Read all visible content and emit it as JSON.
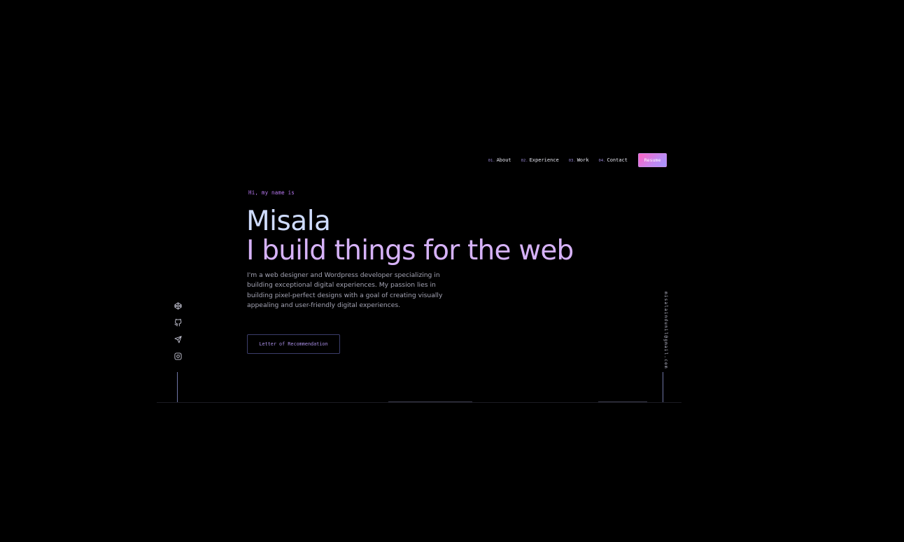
{
  "nav": {
    "items": [
      {
        "num": "01.",
        "label": "About"
      },
      {
        "num": "02.",
        "label": "Experience"
      },
      {
        "num": "03.",
        "label": "Work"
      },
      {
        "num": "04.",
        "label": "Contact"
      }
    ],
    "resume_label": "Resume"
  },
  "hero": {
    "greeting": "Hi, my name is",
    "name": "Misala",
    "tagline": "I build things for the web",
    "bio": "I'm a web designer and Wordpress developer specializing in building exceptional digital experiences.  My passion lies in building pixel-perfect designs with a goal of creating visually appealing and user-friendly digital experiences.",
    "letter_button": "Letter of Recommendation"
  },
  "socials": [
    {
      "icon": "codepen-icon"
    },
    {
      "icon": "github-icon"
    },
    {
      "icon": "telegram-icon"
    },
    {
      "icon": "instagram-icon"
    }
  ],
  "email": "misalaindunil@gmail.com",
  "colors": {
    "background": "#000000",
    "name": "#cfdcff",
    "tagline": "#d6b2f8",
    "accent": "#b979f2",
    "resume_gradient_start": "#ff63c3",
    "resume_gradient_end": "#a597ff"
  }
}
